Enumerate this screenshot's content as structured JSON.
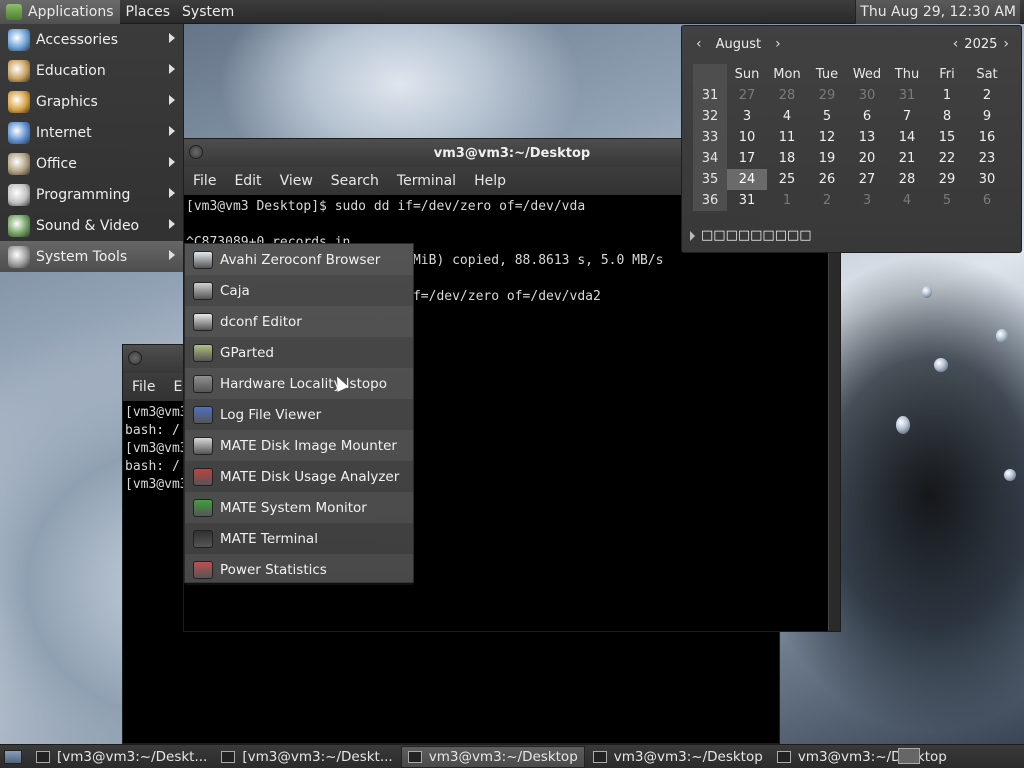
{
  "top_panel": {
    "menus": [
      "Applications",
      "Places",
      "System"
    ],
    "clock": "Thu Aug 29, 12:30 AM"
  },
  "apps_menu": {
    "items": [
      {
        "label": "Accessories",
        "icon": "accessories-icon",
        "color": "#6aa0d8"
      },
      {
        "label": "Education",
        "icon": "education-icon",
        "color": "#c8a060"
      },
      {
        "label": "Graphics",
        "icon": "graphics-icon",
        "color": "#d8a040"
      },
      {
        "label": "Internet",
        "icon": "internet-icon",
        "color": "#5b8fd0"
      },
      {
        "label": "Office",
        "icon": "office-icon",
        "color": "#b0a080"
      },
      {
        "label": "Programming",
        "icon": "programming-icon",
        "color": "#c0c0c0"
      },
      {
        "label": "Sound & Video",
        "icon": "sound-video-icon",
        "color": "#70a060"
      },
      {
        "label": "System Tools",
        "icon": "system-tools-icon",
        "color": "#9a9a9a"
      }
    ]
  },
  "submenu": {
    "items": [
      {
        "label": "Avahi Zeroconf Browser",
        "icon": "avahi-icon",
        "color": "#e0e8f0"
      },
      {
        "label": "Caja",
        "icon": "caja-icon",
        "color": "#d0d0d0"
      },
      {
        "label": "dconf Editor",
        "icon": "dconf-icon",
        "color": "#e8e8e8"
      },
      {
        "label": "GParted",
        "icon": "gparted-icon",
        "color": "#b0c080"
      },
      {
        "label": "Hardware Locality lstopo",
        "icon": "lstopo-icon",
        "color": "#909090"
      },
      {
        "label": "Log File Viewer",
        "icon": "log-viewer-icon",
        "color": "#5070c0"
      },
      {
        "label": "MATE Disk Image Mounter",
        "icon": "disk-mounter-icon",
        "color": "#d8d8d8"
      },
      {
        "label": "MATE Disk Usage Analyzer",
        "icon": "disk-usage-icon",
        "color": "#c04040"
      },
      {
        "label": "MATE System Monitor",
        "icon": "system-monitor-icon",
        "color": "#40a040"
      },
      {
        "label": "MATE Terminal",
        "icon": "terminal-icon",
        "color": "#303030"
      },
      {
        "label": "Power Statistics",
        "icon": "power-stats-icon",
        "color": "#c05050"
      }
    ]
  },
  "main_terminal": {
    "title": "vm3@vm3:~/Desktop",
    "menus": [
      "File",
      "Edit",
      "View",
      "Search",
      "Terminal",
      "Help"
    ],
    "lines": [
      "[vm3@vm3 Desktop]$ sudo dd if=/dev/zero of=/dev/vda",
      "",
      "^C873089+0 records in",
      "                             MiB) copied, 88.8613 s, 5.0 MB/s",
      "",
      "                             f=/dev/zero of=/dev/vda2"
    ]
  },
  "back_terminal": {
    "menus": [
      "File",
      "E"
    ],
    "lines": [
      "[vm3@vm3",
      "bash: /",
      "[vm3@vm3",
      "bash: /",
      "[vm3@vm3"
    ]
  },
  "calendar": {
    "month": "August",
    "year": "2025",
    "weekdays": [
      "Sun",
      "Mon",
      "Tue",
      "Wed",
      "Thu",
      "Fri",
      "Sat"
    ],
    "weeks": [
      {
        "wk": "31",
        "days": [
          "27",
          "28",
          "29",
          "30",
          "31",
          "1",
          "2"
        ],
        "dim": [
          true,
          true,
          true,
          true,
          true,
          false,
          false
        ]
      },
      {
        "wk": "32",
        "days": [
          "3",
          "4",
          "5",
          "6",
          "7",
          "8",
          "9"
        ],
        "dim": [
          false,
          false,
          false,
          false,
          false,
          false,
          false
        ]
      },
      {
        "wk": "33",
        "days": [
          "10",
          "11",
          "12",
          "13",
          "14",
          "15",
          "16"
        ],
        "dim": [
          false,
          false,
          false,
          false,
          false,
          false,
          false
        ]
      },
      {
        "wk": "34",
        "days": [
          "17",
          "18",
          "19",
          "20",
          "21",
          "22",
          "23"
        ],
        "dim": [
          false,
          false,
          false,
          false,
          false,
          false,
          false
        ]
      },
      {
        "wk": "35",
        "days": [
          "24",
          "25",
          "26",
          "27",
          "28",
          "29",
          "30"
        ],
        "dim": [
          false,
          false,
          false,
          false,
          false,
          false,
          false
        ],
        "today": 0
      },
      {
        "wk": "36",
        "days": [
          "31",
          "1",
          "2",
          "3",
          "4",
          "5",
          "6"
        ],
        "dim": [
          false,
          true,
          true,
          true,
          true,
          true,
          true
        ]
      }
    ],
    "footer": "□□□□□□□□□"
  },
  "taskbar": {
    "tasks": [
      {
        "label": "[vm3@vm3:~/Deskt...",
        "active": false
      },
      {
        "label": "[vm3@vm3:~/Deskt...",
        "active": false
      },
      {
        "label": "vm3@vm3:~/Desktop",
        "active": true
      },
      {
        "label": "vm3@vm3:~/Desktop",
        "active": false
      },
      {
        "label": "vm3@vm3:~/Desktop",
        "active": false
      }
    ]
  }
}
